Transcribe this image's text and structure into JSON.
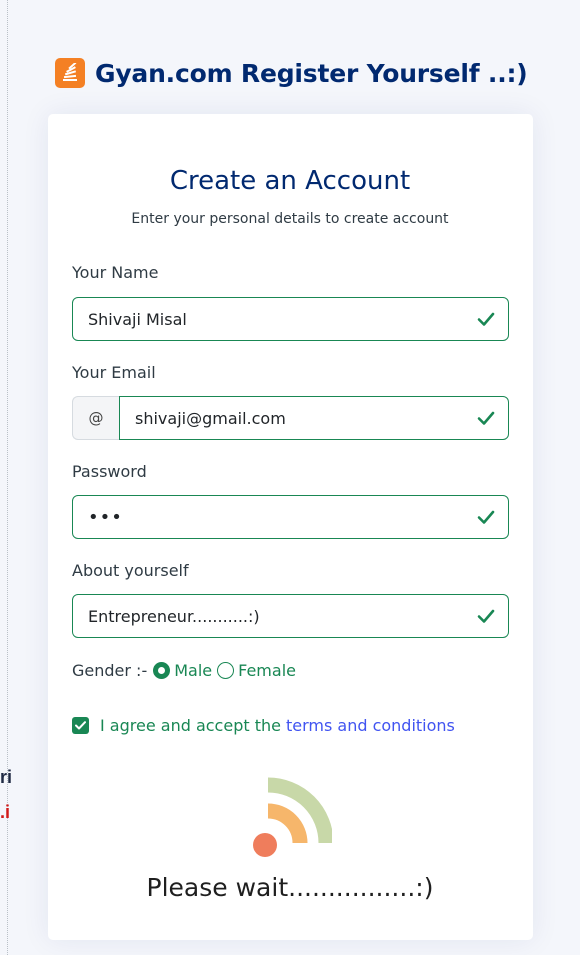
{
  "brand": {
    "title": "Gyan.com Register Yourself ..:)"
  },
  "form": {
    "title": "Create an Account",
    "subtitle": "Enter your personal details to create account",
    "name": {
      "label": "Your Name",
      "value": "Shivaji Misal"
    },
    "email": {
      "label": "Your Email",
      "prefix": "@",
      "value": "shivaji@gmail.com"
    },
    "password": {
      "label": "Password",
      "value": "•••"
    },
    "about": {
      "label": "About yourself",
      "value": "Entrepreneur...........:)"
    },
    "gender": {
      "label": "Gender :-",
      "options": [
        "Male",
        "Female"
      ],
      "selected": "Male"
    },
    "terms": {
      "text": "I agree and accept the",
      "link": "terms and conditions",
      "checked": true
    }
  },
  "loading": {
    "text": "Please wait................:)"
  },
  "edge_fragments": [
    "ri",
    ".i"
  ],
  "colors": {
    "brand_navy": "#012970",
    "valid_green": "#198754",
    "link_blue": "#4154f1",
    "logo_orange": "#f48024",
    "loader_green": "#c8d8a8",
    "loader_orange": "#f6b66b",
    "loader_red": "#ef7d5c"
  }
}
